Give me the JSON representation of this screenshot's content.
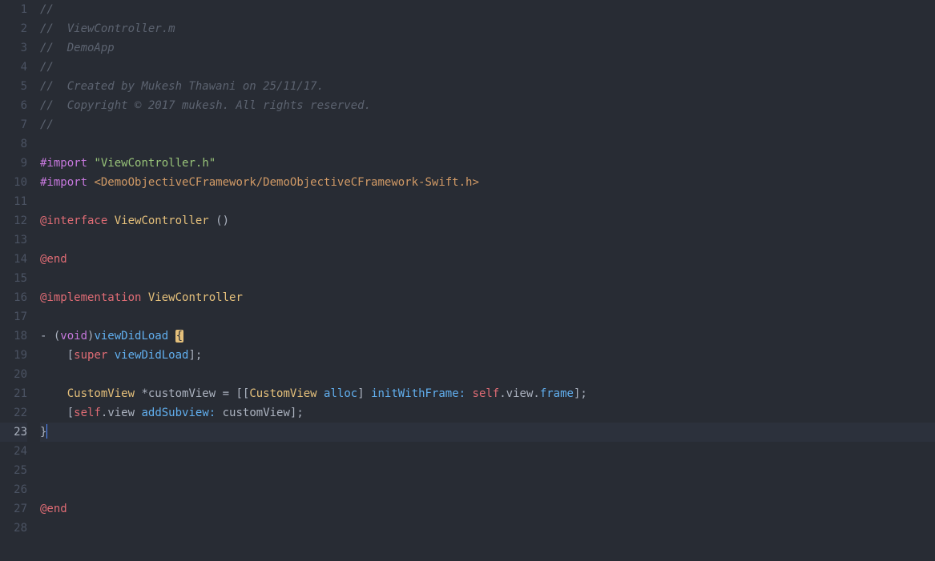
{
  "lines": [
    {
      "num": "1",
      "tokens": [
        {
          "cls": "comment",
          "text": "//"
        }
      ]
    },
    {
      "num": "2",
      "tokens": [
        {
          "cls": "comment",
          "text": "//  ViewController.m"
        }
      ]
    },
    {
      "num": "3",
      "tokens": [
        {
          "cls": "comment",
          "text": "//  DemoApp"
        }
      ]
    },
    {
      "num": "4",
      "tokens": [
        {
          "cls": "comment",
          "text": "//"
        }
      ]
    },
    {
      "num": "5",
      "tokens": [
        {
          "cls": "comment",
          "text": "//  Created by Mukesh Thawani on 25/11/17."
        }
      ]
    },
    {
      "num": "6",
      "tokens": [
        {
          "cls": "comment",
          "text": "//  Copyright © 2017 mukesh. All rights reserved."
        }
      ]
    },
    {
      "num": "7",
      "tokens": [
        {
          "cls": "comment",
          "text": "//"
        }
      ]
    },
    {
      "num": "8",
      "tokens": []
    },
    {
      "num": "9",
      "tokens": [
        {
          "cls": "hash",
          "text": "#import"
        },
        {
          "cls": "punct",
          "text": " "
        },
        {
          "cls": "string",
          "text": "\"ViewController.h\""
        }
      ]
    },
    {
      "num": "10",
      "tokens": [
        {
          "cls": "hash",
          "text": "#import"
        },
        {
          "cls": "punct",
          "text": " "
        },
        {
          "cls": "string-angle",
          "text": "<DemoObjectiveCFramework/DemoObjectiveCFramework-Swift.h>"
        }
      ]
    },
    {
      "num": "11",
      "tokens": []
    },
    {
      "num": "12",
      "tokens": [
        {
          "cls": "keyword-at",
          "text": "@interface"
        },
        {
          "cls": "punct",
          "text": " "
        },
        {
          "cls": "type",
          "text": "ViewController"
        },
        {
          "cls": "punct",
          "text": " ()"
        }
      ]
    },
    {
      "num": "13",
      "tokens": []
    },
    {
      "num": "14",
      "tokens": [
        {
          "cls": "keyword-at",
          "text": "@end"
        }
      ]
    },
    {
      "num": "15",
      "tokens": []
    },
    {
      "num": "16",
      "tokens": [
        {
          "cls": "keyword-at",
          "text": "@implementation"
        },
        {
          "cls": "punct",
          "text": " "
        },
        {
          "cls": "type",
          "text": "ViewController"
        }
      ]
    },
    {
      "num": "17",
      "tokens": []
    },
    {
      "num": "18",
      "tokens": [
        {
          "cls": "punct",
          "text": "- ("
        },
        {
          "cls": "builtin",
          "text": "void"
        },
        {
          "cls": "punct",
          "text": ")"
        },
        {
          "cls": "method",
          "text": "viewDidLoad"
        },
        {
          "cls": "punct",
          "text": " "
        },
        {
          "cls": "brace-hl",
          "text": "{"
        }
      ]
    },
    {
      "num": "19",
      "tokens": [
        {
          "cls": "punct",
          "text": "    ["
        },
        {
          "cls": "self",
          "text": "super"
        },
        {
          "cls": "punct",
          "text": " "
        },
        {
          "cls": "method",
          "text": "viewDidLoad"
        },
        {
          "cls": "punct",
          "text": "];"
        }
      ]
    },
    {
      "num": "20",
      "tokens": []
    },
    {
      "num": "21",
      "tokens": [
        {
          "cls": "punct",
          "text": "    "
        },
        {
          "cls": "type",
          "text": "CustomView"
        },
        {
          "cls": "punct",
          "text": " *customView = [["
        },
        {
          "cls": "type",
          "text": "CustomView"
        },
        {
          "cls": "punct",
          "text": " "
        },
        {
          "cls": "method",
          "text": "alloc"
        },
        {
          "cls": "punct",
          "text": "] "
        },
        {
          "cls": "method",
          "text": "initWithFrame:"
        },
        {
          "cls": "punct",
          "text": " "
        },
        {
          "cls": "self",
          "text": "self"
        },
        {
          "cls": "punct",
          "text": "."
        },
        {
          "cls": "prop",
          "text": "view"
        },
        {
          "cls": "punct",
          "text": "."
        },
        {
          "cls": "method",
          "text": "frame"
        },
        {
          "cls": "punct",
          "text": "];"
        }
      ]
    },
    {
      "num": "22",
      "tokens": [
        {
          "cls": "punct",
          "text": "    ["
        },
        {
          "cls": "self",
          "text": "self"
        },
        {
          "cls": "punct",
          "text": "."
        },
        {
          "cls": "prop",
          "text": "view"
        },
        {
          "cls": "punct",
          "text": " "
        },
        {
          "cls": "method",
          "text": "addSubview:"
        },
        {
          "cls": "punct",
          "text": " customView];"
        }
      ]
    },
    {
      "num": "23",
      "highlighted": true,
      "cursor": true,
      "tokens": [
        {
          "cls": "punct",
          "text": "}"
        }
      ]
    },
    {
      "num": "24",
      "tokens": []
    },
    {
      "num": "25",
      "tokens": []
    },
    {
      "num": "26",
      "tokens": []
    },
    {
      "num": "27",
      "tokens": [
        {
          "cls": "keyword-at",
          "text": "@end"
        }
      ]
    },
    {
      "num": "28",
      "tokens": []
    }
  ]
}
